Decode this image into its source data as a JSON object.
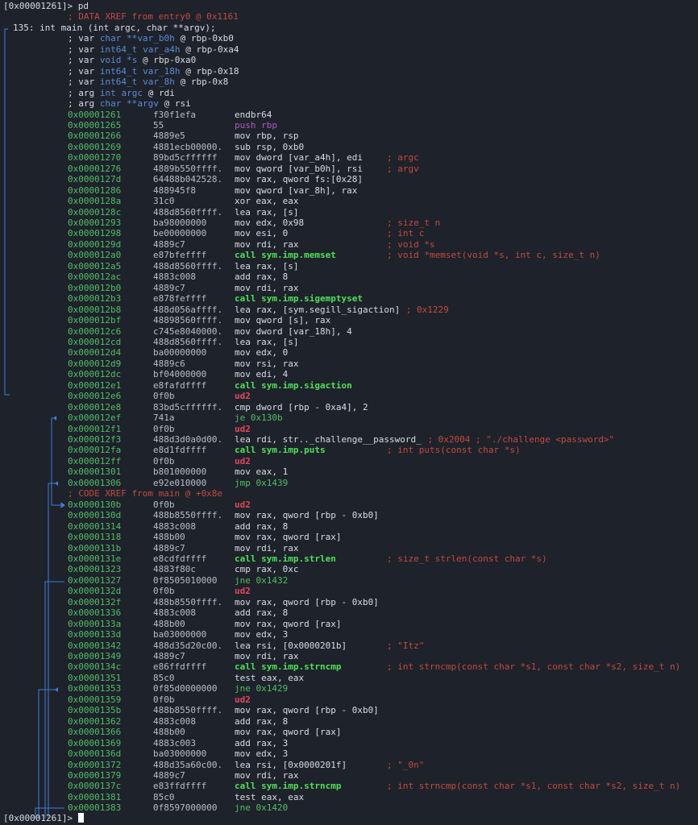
{
  "prompt_top": "[0x00001261]> pd",
  "prompt_bottom": "[0x00001261]> ",
  "xref_entry": "; DATA XREF from entry0 @ 0x1161",
  "func_sig": "135: int main (int argc, char **argv);",
  "vars": [
    {
      "a": "; var ",
      "t": "char **",
      "n": "var_b0h",
      "r": " @ rbp-0xb0"
    },
    {
      "a": "; var ",
      "t": "int64_t ",
      "n": "var_a4h",
      "r": " @ rbp-0xa4"
    },
    {
      "a": "; var ",
      "t": "void *",
      "n": "s",
      "r": " @ rbp-0xa0"
    },
    {
      "a": "; var ",
      "t": "int64_t ",
      "n": "var_18h",
      "r": " @ rbp-0x18"
    },
    {
      "a": "; var ",
      "t": "int64_t ",
      "n": "var_8h",
      "r": " @ rbp-0x8"
    },
    {
      "a": "; arg ",
      "t": "int ",
      "n": "argc",
      "r": " @ rdi"
    },
    {
      "a": "; arg ",
      "t": "char **",
      "n": "argv",
      "r": " @ rsi"
    }
  ],
  "lines": [
    {
      "addr": "0x00001261",
      "bytes": "f30f1efa",
      "op": "endbr64",
      "k": "num"
    },
    {
      "addr": "0x00001265",
      "bytes": "55",
      "op": "push rbp",
      "k": "push"
    },
    {
      "addr": "0x00001266",
      "bytes": "4889e5",
      "op": "mov rbp, rsp",
      "k": "num"
    },
    {
      "addr": "0x00001269",
      "bytes": "4881ecb00000.",
      "op": "sub rsp, 0xb0",
      "k": "num"
    },
    {
      "addr": "0x00001270",
      "bytes": "89bd5cffffff",
      "op": "mov dword [var_a4h], edi",
      "k": "num",
      "cmt": "; argc"
    },
    {
      "addr": "0x00001276",
      "bytes": "4889b550ffff.",
      "op": "mov qword [var_b0h], rsi",
      "k": "num",
      "cmt": "; argv"
    },
    {
      "addr": "0x0000127d",
      "bytes": "64488b042528.",
      "op": "mov rax, qword fs:[0x28]",
      "k": "num"
    },
    {
      "addr": "0x00001286",
      "bytes": "488945f8",
      "op": "mov qword [var_8h], rax",
      "k": "num"
    },
    {
      "addr": "0x0000128a",
      "bytes": "31c0",
      "op": "xor eax, eax",
      "k": "num"
    },
    {
      "addr": "0x0000128c",
      "bytes": "488d8560ffff.",
      "op": "lea rax, [s]",
      "k": "num"
    },
    {
      "addr": "0x00001293",
      "bytes": "ba98000000",
      "op": "mov edx, 0x98",
      "k": "num",
      "cmt": "; size_t n"
    },
    {
      "addr": "0x00001298",
      "bytes": "be00000000",
      "op": "mov esi, 0",
      "k": "num",
      "cmt": "; int c"
    },
    {
      "addr": "0x0000129d",
      "bytes": "4889c7",
      "op": "mov rdi, rax",
      "k": "num",
      "cmt": "; void *s"
    },
    {
      "addr": "0x000012a0",
      "bytes": "e87bfeffff",
      "op": "call sym.imp.memset",
      "k": "call",
      "cmt": "; void *memset(void *s, int c, size_t n)"
    },
    {
      "addr": "0x000012a5",
      "bytes": "488d8560ffff.",
      "op": "lea rax, [s]",
      "k": "num"
    },
    {
      "addr": "0x000012ac",
      "bytes": "4883c008",
      "op": "add rax, 8",
      "k": "num"
    },
    {
      "addr": "0x000012b0",
      "bytes": "4889c7",
      "op": "mov rdi, rax",
      "k": "num"
    },
    {
      "addr": "0x000012b3",
      "bytes": "e878feffff",
      "op": "call sym.imp.sigemptyset",
      "k": "call"
    },
    {
      "addr": "0x000012b8",
      "bytes": "488d056affff.",
      "op": "lea rax, [sym.segill_sigaction]",
      "k": "num",
      "cmt": "; 0x1229"
    },
    {
      "addr": "0x000012bf",
      "bytes": "48898560ffff.",
      "op": "mov qword [s], rax",
      "k": "num"
    },
    {
      "addr": "0x000012c6",
      "bytes": "c745e8040000.",
      "op": "mov dword [var_18h], 4",
      "k": "num"
    },
    {
      "addr": "0x000012cd",
      "bytes": "488d8560ffff.",
      "op": "lea rax, [s]",
      "k": "num"
    },
    {
      "addr": "0x000012d4",
      "bytes": "ba00000000",
      "op": "mov edx, 0",
      "k": "num"
    },
    {
      "addr": "0x000012d9",
      "bytes": "4889c6",
      "op": "mov rsi, rax",
      "k": "num"
    },
    {
      "addr": "0x000012dc",
      "bytes": "bf04000000",
      "op": "mov edi, 4",
      "k": "num"
    },
    {
      "addr": "0x000012e1",
      "bytes": "e8fafdffff",
      "op": "call sym.imp.sigaction",
      "k": "call"
    },
    {
      "addr": "0x000012e6",
      "bytes": "0f0b",
      "op": "ud2",
      "k": "ud"
    },
    {
      "addr": "0x000012e8",
      "bytes": "83bd5cffffff.",
      "op": "cmp dword [rbp - 0xa4], 2",
      "k": "num"
    },
    {
      "addr": "0x000012ef",
      "bytes": "741a",
      "op": "je 0x130b",
      "k": "jmp"
    },
    {
      "addr": "0x000012f1",
      "bytes": "0f0b",
      "op": "ud2",
      "k": "ud"
    },
    {
      "addr": "0x000012f3",
      "bytes": "488d3d0a0d00.",
      "op": "lea rdi, str.._challenge__password_",
      "k": "num",
      "cmt": "; 0x2004 ; \"./challenge <password>\""
    },
    {
      "addr": "0x000012fa",
      "bytes": "e8d1fdffff",
      "op": "call sym.imp.puts",
      "k": "call",
      "cmt": "; int puts(const char *s)"
    },
    {
      "addr": "0x000012ff",
      "bytes": "0f0b",
      "op": "ud2",
      "k": "ud"
    },
    {
      "addr": "0x00001301",
      "bytes": "b801000000",
      "op": "mov eax, 1",
      "k": "num"
    },
    {
      "addr": "0x00001306",
      "bytes": "e92e010000",
      "op": "jmp 0x1439",
      "k": "jmp"
    },
    {
      "xref": "; CODE XREF from main @ +0x8e"
    },
    {
      "addr": "0x0000130b",
      "bytes": "0f0b",
      "op": "ud2",
      "k": "ud"
    },
    {
      "addr": "0x0000130d",
      "bytes": "488b8550ffff.",
      "op": "mov rax, qword [rbp - 0xb0]",
      "k": "num"
    },
    {
      "addr": "0x00001314",
      "bytes": "4883c008",
      "op": "add rax, 8",
      "k": "num"
    },
    {
      "addr": "0x00001318",
      "bytes": "488b00",
      "op": "mov rax, qword [rax]",
      "k": "num"
    },
    {
      "addr": "0x0000131b",
      "bytes": "4889c7",
      "op": "mov rdi, rax",
      "k": "num"
    },
    {
      "addr": "0x0000131e",
      "bytes": "e8cdfdffff",
      "op": "call sym.imp.strlen",
      "k": "call",
      "cmt": "; size_t strlen(const char *s)"
    },
    {
      "addr": "0x00001323",
      "bytes": "4883f80c",
      "op": "cmp rax, 0xc",
      "k": "num"
    },
    {
      "addr": "0x00001327",
      "bytes": "0f8505010000",
      "op": "jne 0x1432",
      "k": "jmp"
    },
    {
      "addr": "0x0000132d",
      "bytes": "0f0b",
      "op": "ud2",
      "k": "ud"
    },
    {
      "addr": "0x0000132f",
      "bytes": "488b8550ffff.",
      "op": "mov rax, qword [rbp - 0xb0]",
      "k": "num"
    },
    {
      "addr": "0x00001336",
      "bytes": "4883c008",
      "op": "add rax, 8",
      "k": "num"
    },
    {
      "addr": "0x0000133a",
      "bytes": "488b00",
      "op": "mov rax, qword [rax]",
      "k": "num"
    },
    {
      "addr": "0x0000133d",
      "bytes": "ba03000000",
      "op": "mov edx, 3",
      "k": "num"
    },
    {
      "addr": "0x00001342",
      "bytes": "488d35d20c00.",
      "op": "lea rsi, [0x0000201b]",
      "k": "num",
      "cmt": "; \"Itz\""
    },
    {
      "addr": "0x00001349",
      "bytes": "4889c7",
      "op": "mov rdi, rax",
      "k": "num"
    },
    {
      "addr": "0x0000134c",
      "bytes": "e86ffdffff",
      "op": "call sym.imp.strncmp",
      "k": "call",
      "cmt": "; int strncmp(const char *s1, const char *s2, size_t n)"
    },
    {
      "addr": "0x00001351",
      "bytes": "85c0",
      "op": "test eax, eax",
      "k": "num"
    },
    {
      "addr": "0x00001353",
      "bytes": "0f85d0000000",
      "op": "jne 0x1429",
      "k": "jmp"
    },
    {
      "addr": "0x00001359",
      "bytes": "0f0b",
      "op": "ud2",
      "k": "ud"
    },
    {
      "addr": "0x0000135b",
      "bytes": "488b8550ffff.",
      "op": "mov rax, qword [rbp - 0xb0]",
      "k": "num"
    },
    {
      "addr": "0x00001362",
      "bytes": "4883c008",
      "op": "add rax, 8",
      "k": "num"
    },
    {
      "addr": "0x00001366",
      "bytes": "488b00",
      "op": "mov rax, qword [rax]",
      "k": "num"
    },
    {
      "addr": "0x00001369",
      "bytes": "4883c003",
      "op": "add rax, 3",
      "k": "num"
    },
    {
      "addr": "0x0000136d",
      "bytes": "ba03000000",
      "op": "mov edx, 3",
      "k": "num"
    },
    {
      "addr": "0x00001372",
      "bytes": "488d35a60c00.",
      "op": "lea rsi, [0x0000201f]",
      "k": "num",
      "cmt": "; \"_0n\""
    },
    {
      "addr": "0x00001379",
      "bytes": "4889c7",
      "op": "mov rdi, rax",
      "k": "num"
    },
    {
      "addr": "0x0000137c",
      "bytes": "e83ffdffff",
      "op": "call sym.imp.strncmp",
      "k": "call",
      "cmt": "; int strncmp(const char *s1, const char *s2, size_t n)"
    },
    {
      "addr": "0x00001381",
      "bytes": "85c0",
      "op": "test eax, eax",
      "k": "num"
    },
    {
      "addr": "0x00001383",
      "bytes": "0f8597000000",
      "op": "jne 0x1420",
      "k": "jmp"
    }
  ],
  "colors": {
    "background": "#1e222a",
    "address": "#4fbf67",
    "comment": "#c34a40",
    "call": "#4fe05a",
    "ud2": "#e0485a",
    "push": "#b05ac0",
    "type": "#5d8bd8"
  }
}
